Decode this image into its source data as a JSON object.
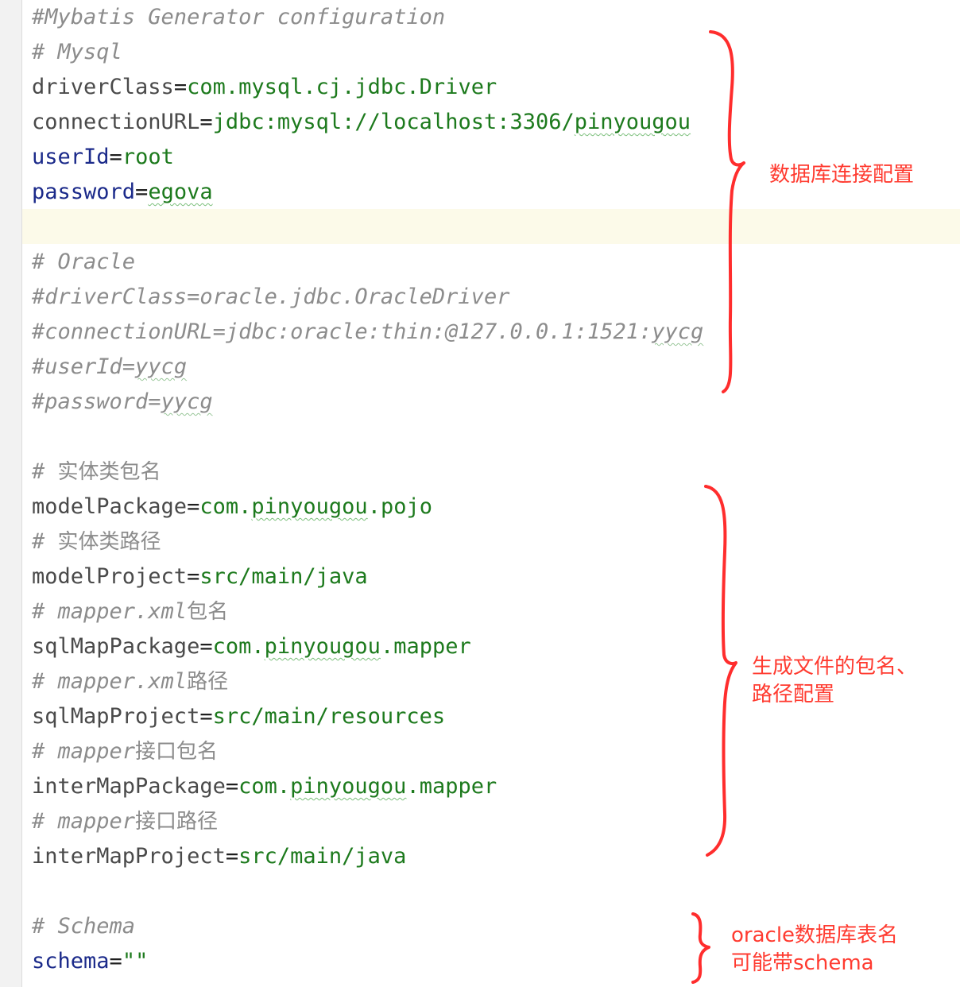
{
  "editor": {
    "lines": {
      "l1": "#Mybatis Generator configuration",
      "l2": "# Mysql",
      "l3_key": "driverClass",
      "l3_val": "com.mysql.cj.jdbc.Driver",
      "l4_key": "connectionURL",
      "l4_val_a": "jdbc:mysql://localhost:3306/",
      "l4_val_b": "pinyougou",
      "l5_key": "userId",
      "l5_val": "root",
      "l6_key": "password",
      "l6_val": "egova",
      "l8": "# Oracle",
      "l9": "#driverClass=oracle.jdbc.OracleDriver",
      "l10_a": "#connectionURL=jdbc:oracle:thin:@127.0.0.1:1521:",
      "l10_b": "yycg",
      "l11_a": "#userId=",
      "l11_b": "yycg",
      "l12_a": "#password=",
      "l12_b": "yycg",
      "l14_a": "# ",
      "l14_b": "实体类包名",
      "l15_key": "modelPackage",
      "l15_val_a": "com.",
      "l15_val_b": "pinyougou",
      "l15_val_c": ".pojo",
      "l16_a": "# ",
      "l16_b": "实体类路径",
      "l17_key": "modelProject",
      "l17_val": "src/main/java",
      "l18_a": "# mapper.xml",
      "l18_b": "包名",
      "l19_key": "sqlMapPackage",
      "l19_val_a": "com.",
      "l19_val_b": "pinyougou",
      "l19_val_c": ".mapper",
      "l20_a": "# mapper.xml",
      "l20_b": "路径",
      "l21_key": "sqlMapProject",
      "l21_val": "src/main/resources",
      "l22_a": "# mapper",
      "l22_b": "接口包名",
      "l23_key": "interMapPackage",
      "l23_val_a": "com.",
      "l23_val_b": "pinyougou",
      "l23_val_c": ".mapper",
      "l24_a": "# mapper",
      "l24_b": "接口路径",
      "l25_key": "interMapProject",
      "l25_val": "src/main/java",
      "l27": "# Schema",
      "l28_key": "schema",
      "l28_val": "\"\"",
      "eq": "="
    }
  },
  "annotations": {
    "db_note": "数据库连接配置",
    "path_note": "生成文件的包名、\n路径配置",
    "schema_note": "oracle数据库表名\n可能带schema",
    "color": "#ff3b30"
  }
}
